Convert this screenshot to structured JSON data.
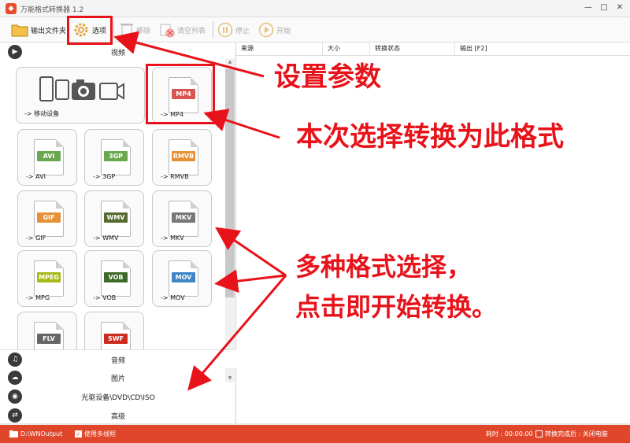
{
  "window": {
    "title": "万能格式转换器 1.2",
    "controls": [
      "—",
      "□",
      "✕"
    ]
  },
  "toolbar": {
    "output_folder": "输出文件夹",
    "options": "选项",
    "remove": "移除",
    "clear_list": "清空列表",
    "stop": "停止",
    "start": "开始"
  },
  "categories": {
    "video": "视频",
    "audio": "音频",
    "image": "图片",
    "disc": "光驱设备\\DVD\\CD\\ISO",
    "advanced": "高级"
  },
  "tiles": [
    {
      "label": "-> 移动设备",
      "badge": "",
      "color": ""
    },
    {
      "label": "-> MP4",
      "badge": "MP4",
      "color": "#d9534f"
    },
    {
      "label": "-> AVI",
      "badge": "AVI",
      "color": "#6aa84f"
    },
    {
      "label": "-> 3GP",
      "badge": "3GP",
      "color": "#6aa84f"
    },
    {
      "label": "-> RMVB",
      "badge": "RMVB",
      "color": "#e69138"
    },
    {
      "label": "-> GIF",
      "badge": "GIF",
      "color": "#e69138"
    },
    {
      "label": "-> WMV",
      "badge": "WMV",
      "color": "#556b2f"
    },
    {
      "label": "-> MKV",
      "badge": "MKV",
      "color": "#777777"
    },
    {
      "label": "-> MPG",
      "badge": "MPEG",
      "color": "#a6b81a"
    },
    {
      "label": "-> VOB",
      "badge": "VOB",
      "color": "#3d6b2a"
    },
    {
      "label": "-> MOV",
      "badge": "MOV",
      "color": "#3d85c6"
    },
    {
      "label": "",
      "badge": "FLV",
      "color": "#666666"
    },
    {
      "label": "",
      "badge": "SWF",
      "color": "#cc2a1e"
    }
  ],
  "table": {
    "headers": [
      "来源",
      "大小",
      "转换状态",
      "输出 [F2]"
    ]
  },
  "status": {
    "output_path": "D:\\WNOutput",
    "multithread": "使用多线程",
    "elapsed": "耗时 : 00:00:00",
    "after_done": "转换完成后 : 关闭电脑"
  },
  "annotations": {
    "settings": "设置参数",
    "format": "本次选择转换为此格式",
    "multi_line1": "多种格式选择，",
    "multi_line2": "点击即开始转换。"
  },
  "colors": {
    "accent": "#e0462a",
    "annotation": "#e8131a"
  }
}
